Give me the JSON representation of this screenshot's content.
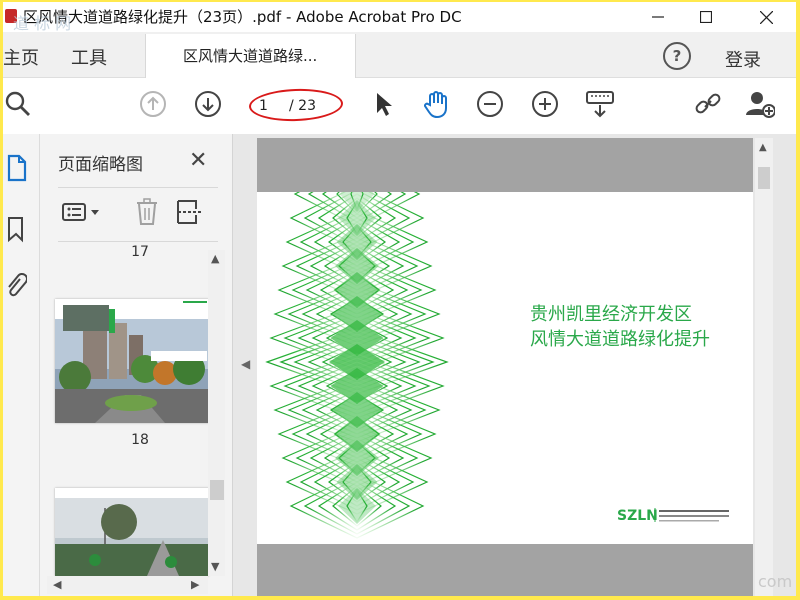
{
  "window": {
    "title": "区风情大道道路绿化提升（23页）.pdf - Adobe Acrobat Pro DC",
    "controls": [
      "minimize",
      "maximize",
      "close"
    ]
  },
  "watermark": {
    "top": "道 标 网",
    "bottom": "com"
  },
  "menubar": {
    "home": "主页",
    "tools": "工具",
    "doc_tab": "区风情大道道路绿...",
    "help": "?",
    "login": "登录"
  },
  "toolbar": {
    "page_current": "1",
    "page_total": "/ 23",
    "icons": [
      "search-icon",
      "page-up-icon",
      "page-down-icon",
      "select-arrow-icon",
      "hand-icon",
      "zoom-out-icon",
      "zoom-in-icon",
      "keyboard-icon",
      "share-link-icon",
      "add-user-icon"
    ]
  },
  "thumbnails_panel": {
    "title": "页面缩略图",
    "close": "✕",
    "pages": [
      {
        "label": "17"
      },
      {
        "label": "18"
      },
      {
        "label": ""
      }
    ]
  },
  "slide": {
    "line1": "贵州凯里经济开发区",
    "line2": "风情大道道路绿化提升",
    "logo_text": "SZLN",
    "accent_color": "#2aa84a"
  },
  "colors": {
    "accent_green": "#2aa84a",
    "highlight_red": "#d91a1a",
    "band_gray": "#a3a3a3",
    "toolbar_blue": "#1a73c9"
  }
}
